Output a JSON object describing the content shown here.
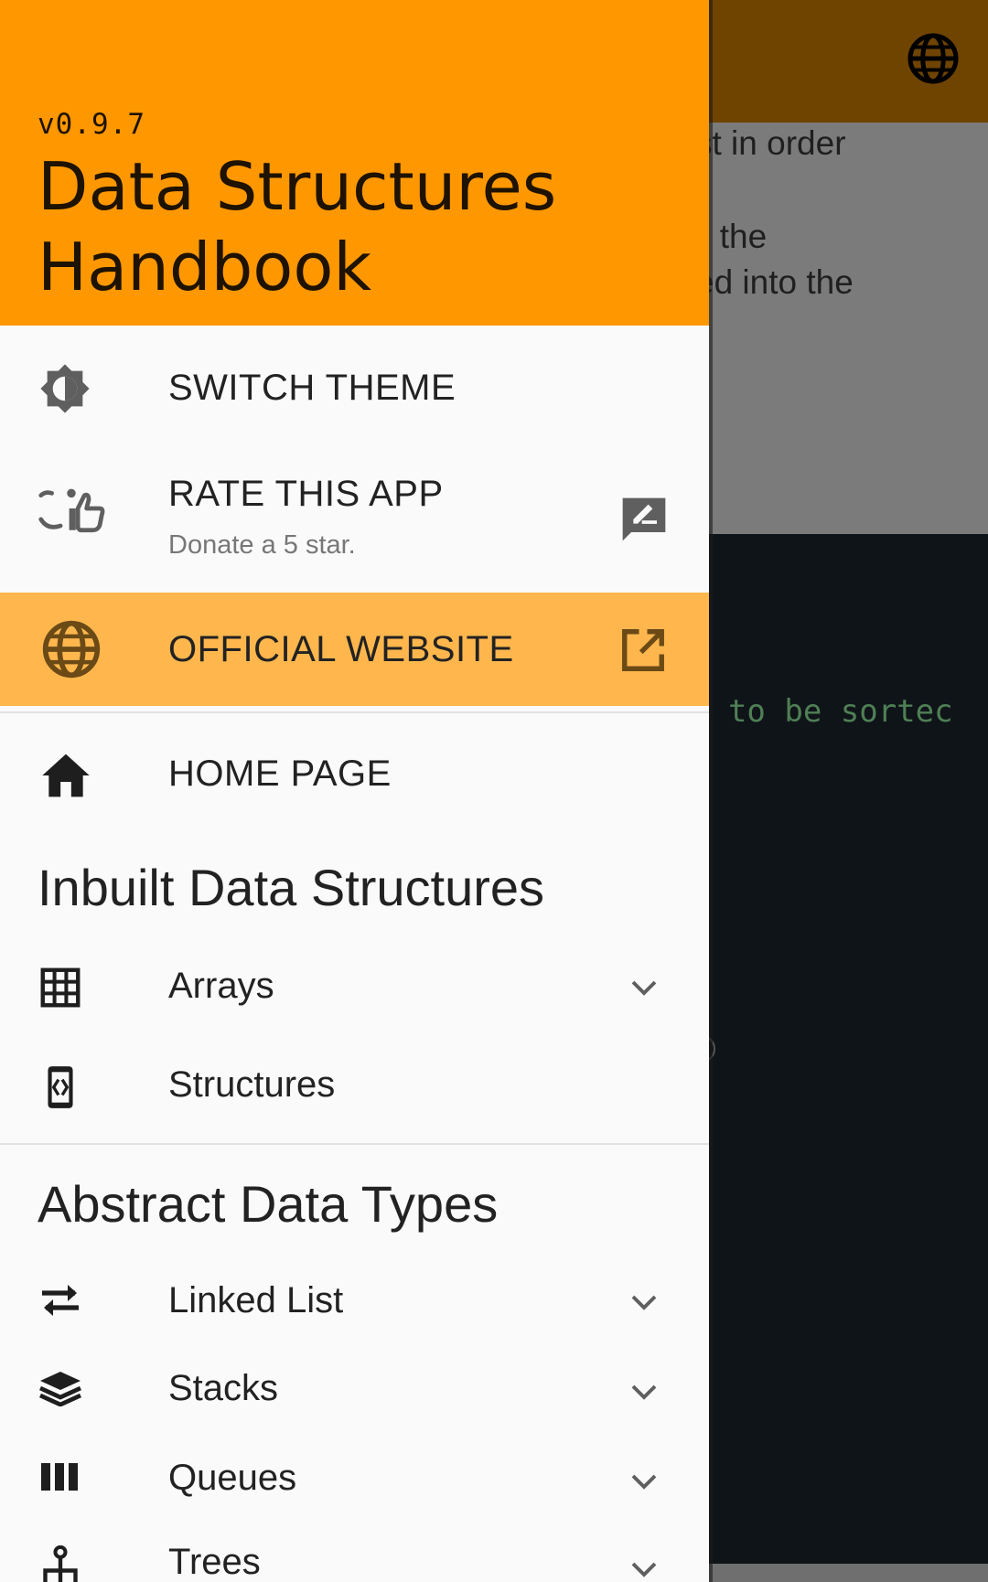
{
  "background": {
    "text_lines": [
      "st in order",
      "ll the",
      "ed into the"
    ],
    "code_line": "s to be sortec"
  },
  "drawer": {
    "version": "v0.9.7",
    "title": "Data Structures Handbook",
    "menu": {
      "switch_theme": "SWITCH THEME",
      "rate_app": "RATE THIS APP",
      "rate_app_sub": "Donate a 5 star.",
      "official_website": "OFFICIAL WEBSITE",
      "home_page": "HOME PAGE"
    },
    "sections": {
      "inbuilt": "Inbuilt Data Structures",
      "abstract": "Abstract Data Types"
    },
    "inbuilt_items": [
      "Arrays",
      "Structures"
    ],
    "abstract_items": [
      "Linked List",
      "Stacks",
      "Queues",
      "Trees"
    ]
  },
  "colors": {
    "header": "#ff9800",
    "highlight": "#ffb74d",
    "scrim_appbar": "#6f4300"
  },
  "icons": {
    "switch_theme": "brightness-icon",
    "rate_app": "thumb-up-icon",
    "rate_app_trail": "rate-review-icon",
    "official_website": "globe-icon",
    "official_website_trail": "open-in-new-icon",
    "home": "home-icon",
    "arrays": "grid-icon",
    "structures": "code-device-icon",
    "linked_list": "swap-arrows-icon",
    "stacks": "layers-icon",
    "queues": "columns-icon",
    "trees": "tree-icon",
    "expand": "chevron-down-icon"
  }
}
